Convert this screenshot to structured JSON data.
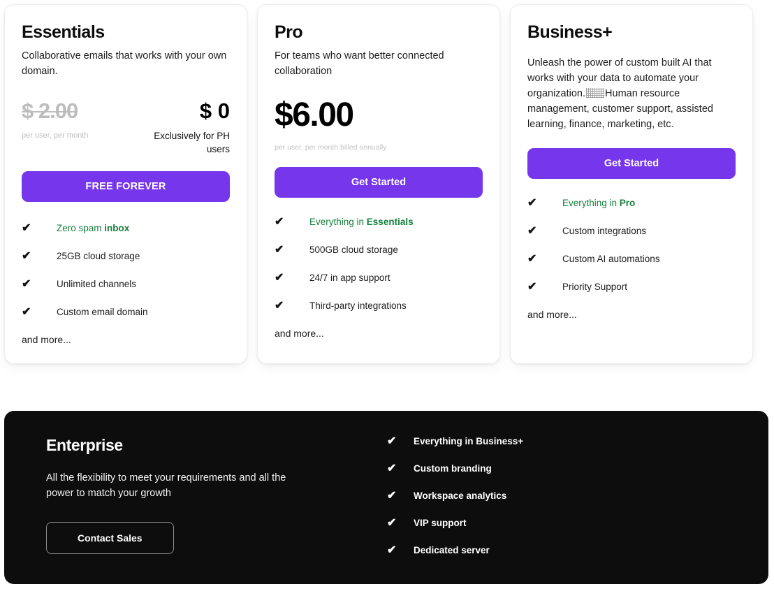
{
  "accent_purple": "#7636ec",
  "accent_green": "#15803d",
  "dark_bg": "#0d0d0d",
  "muted_gray": "#bdbdbd",
  "check_icon": "✔",
  "plans": [
    {
      "name": "Essentials",
      "description": "Collaborative emails that works with your own domain.",
      "old_price": "$ 2.00",
      "old_price_sub": "per user, per month",
      "new_price": "$ 0",
      "price_note": "Exclusively for PH users",
      "cta_label": "FREE FOREVER",
      "features": [
        {
          "text_plain": "Zero spam ",
          "text_bold": "inbox",
          "green": true
        },
        {
          "text_plain": "25GB cloud storage",
          "text_bold": "",
          "green": false
        },
        {
          "text_plain": "Unlimited channels",
          "text_bold": "",
          "green": false
        },
        {
          "text_plain": "Custom email domain",
          "text_bold": "",
          "green": false
        }
      ],
      "and_more": "and more..."
    },
    {
      "name": "Pro",
      "description": "For teams who want better connected collaboration",
      "price": "$6.00",
      "price_sub": "per user, per month billed annually",
      "cta_label": "Get Started",
      "features": [
        {
          "text_plain": "Everything in ",
          "text_bold": "Essentials",
          "green": true
        },
        {
          "text_plain": "500GB cloud storage",
          "text_bold": "",
          "green": false
        },
        {
          "text_plain": "24/7 in app support",
          "text_bold": "",
          "green": false
        },
        {
          "text_plain": "Third-party integrations",
          "text_bold": "",
          "green": false
        }
      ],
      "and_more": "and more..."
    },
    {
      "name": "Business+",
      "description_part1": "Unleash the power of custom built AI that works with your data to automate your organization.",
      "description_part2": "Human resource management, customer support, assisted learning, finance, marketing, etc.",
      "cta_label": "Get Started",
      "features": [
        {
          "text_plain": "Everything in ",
          "text_bold": "Pro",
          "green": true
        },
        {
          "text_plain": "Custom integrations",
          "text_bold": "",
          "green": false
        },
        {
          "text_plain": "Custom AI automations",
          "text_bold": "",
          "green": false
        },
        {
          "text_plain": "Priority Support",
          "text_bold": "",
          "green": false
        }
      ],
      "and_more": "and more..."
    }
  ],
  "enterprise": {
    "title": "Enterprise",
    "description": "All the flexibility to meet your requirements and all the power to match your growth",
    "cta_label": "Contact Sales",
    "check_icon": "✔",
    "features": [
      "Everything in Business+",
      "Custom branding",
      "Workspace analytics",
      "VIP support",
      "Dedicated server"
    ]
  }
}
